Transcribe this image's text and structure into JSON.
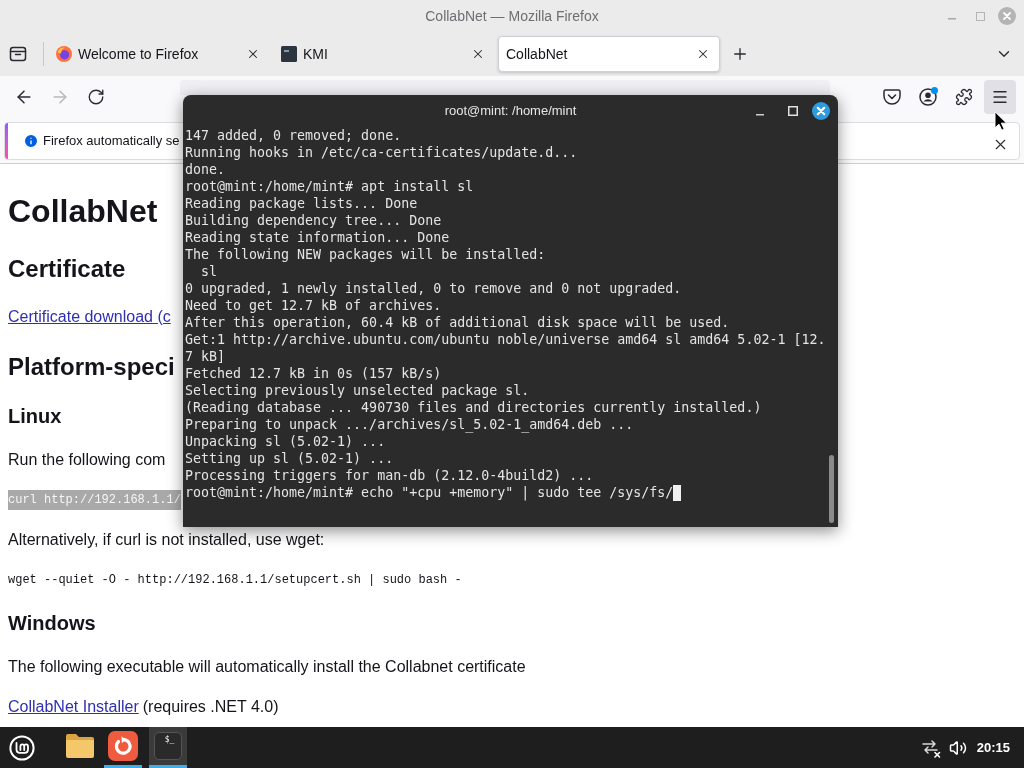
{
  "window": {
    "title": "CollabNet — Mozilla Firefox"
  },
  "tabs": [
    {
      "label": "Welcome to Firefox",
      "selected": false,
      "kind": "globe"
    },
    {
      "label": "KMI",
      "selected": false,
      "kind": "square"
    },
    {
      "label": "CollabNet",
      "selected": true,
      "kind": "plain"
    }
  ],
  "toolbar": {
    "back": {
      "disabled": false
    },
    "forward": {
      "disabled": true
    },
    "account_badge": true,
    "menu_hovered": true
  },
  "notification": {
    "text": "Firefox automatically se"
  },
  "page": {
    "blocks": [
      {
        "kind": "h1",
        "text": "CollabNet"
      },
      {
        "kind": "h2",
        "text": "Certificate"
      },
      {
        "kind": "link",
        "text": "Certificate download (c"
      },
      {
        "kind": "h2",
        "text": "Platform-speci"
      },
      {
        "kind": "h3",
        "text": "Linux"
      },
      {
        "kind": "p",
        "text": "Run the following com"
      },
      {
        "kind": "code",
        "text": "curl http://192.168.1.1/",
        "highlighted": true
      },
      {
        "kind": "p",
        "text": "Alternatively, if curl is not installed, use wget:"
      },
      {
        "kind": "code",
        "text": "wget --quiet -O - http://192.168.1.1/setupcert.sh | sudo bash -",
        "highlighted": false
      },
      {
        "kind": "h3",
        "text": "Windows"
      },
      {
        "kind": "p",
        "text": "The following executable will automatically install the Collabnet certificate"
      },
      {
        "kind": "link_line",
        "link": "CollabNet Installer",
        "text": "(requires .NET 4.0)"
      }
    ]
  },
  "terminal": {
    "title": "root@mint: /home/mint",
    "lines": [
      "147 added, 0 removed; done.",
      "Running hooks in /etc/ca-certificates/update.d...",
      "done.",
      "root@mint:/home/mint# apt install sl",
      "Reading package lists... Done",
      "Building dependency tree... Done",
      "Reading state information... Done",
      "The following NEW packages will be installed:",
      "  sl",
      "0 upgraded, 1 newly installed, 0 to remove and 0 not upgraded.",
      "Need to get 12.7 kB of archives.",
      "After this operation, 60.4 kB of additional disk space will be used.",
      "Get:1 http://archive.ubuntu.com/ubuntu noble/universe amd64 sl amd64 5.02-1 [12.",
      "7 kB]",
      "Fetched 12.7 kB in 0s (157 kB/s)",
      "Selecting previously unselected package sl.",
      "(Reading database ... 490730 files and directories currently installed.)",
      "Preparing to unpack .../archives/sl_5.02-1_amd64.deb ...",
      "Unpacking sl (5.02-1) ...",
      "Setting up sl (5.02-1) ...",
      "Processing triggers for man-db (2.12.0-4build2) ...",
      "root@mint:/home/mint# echo \"+cpu +memory\" | sudo tee /sys/fs/"
    ]
  },
  "taskbar": {
    "launchers": [
      {
        "kind": "folder",
        "running": false,
        "active": false
      },
      {
        "kind": "swirl",
        "running": true,
        "active": false
      },
      {
        "kind": "terminal",
        "glyph": "$_",
        "running": true,
        "active": true
      }
    ],
    "network_connected": false,
    "clock": "20:15"
  }
}
